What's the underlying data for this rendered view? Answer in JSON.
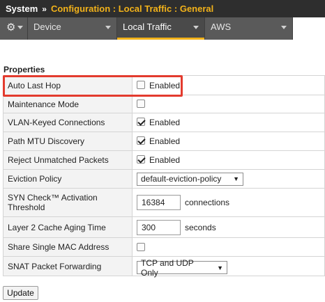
{
  "header": {
    "root": "System",
    "separator": "»",
    "path": "Configuration : Local Traffic : General"
  },
  "nav": {
    "gear_icon": "gear-icon",
    "tabs": [
      {
        "label": "Device"
      },
      {
        "label": "Local Traffic",
        "active": true
      },
      {
        "label": "AWS"
      }
    ]
  },
  "section": {
    "title": "Properties"
  },
  "properties": {
    "auto_last_hop": {
      "label": "Auto Last Hop",
      "checked": false,
      "text": "Enabled"
    },
    "maintenance_mode": {
      "label": "Maintenance Mode",
      "checked": false
    },
    "vlan_keyed": {
      "label": "VLAN-Keyed Connections",
      "checked": true,
      "text": "Enabled"
    },
    "path_mtu": {
      "label": "Path MTU Discovery",
      "checked": true,
      "text": "Enabled"
    },
    "reject_unmatched": {
      "label": "Reject Unmatched Packets",
      "checked": true,
      "text": "Enabled"
    },
    "eviction_policy": {
      "label": "Eviction Policy",
      "value": "default-eviction-policy"
    },
    "syn_check": {
      "label_line1": "SYN Check™ Activation",
      "label_line2": "Threshold",
      "value": "16384",
      "unit": "connections"
    },
    "l2_cache": {
      "label": "Layer 2 Cache Aging Time",
      "value": "300",
      "unit": "seconds"
    },
    "share_mac": {
      "label": "Share Single MAC Address",
      "checked": false
    },
    "snat_forwarding": {
      "label": "SNAT Packet Forwarding",
      "value": "TCP and UDP Only"
    }
  },
  "actions": {
    "update_label": "Update"
  },
  "colors": {
    "accent": "#f2b21a",
    "highlight": "#e33b2e",
    "header_bg": "#2e2e2e",
    "nav_bg": "#5a5a5a"
  }
}
